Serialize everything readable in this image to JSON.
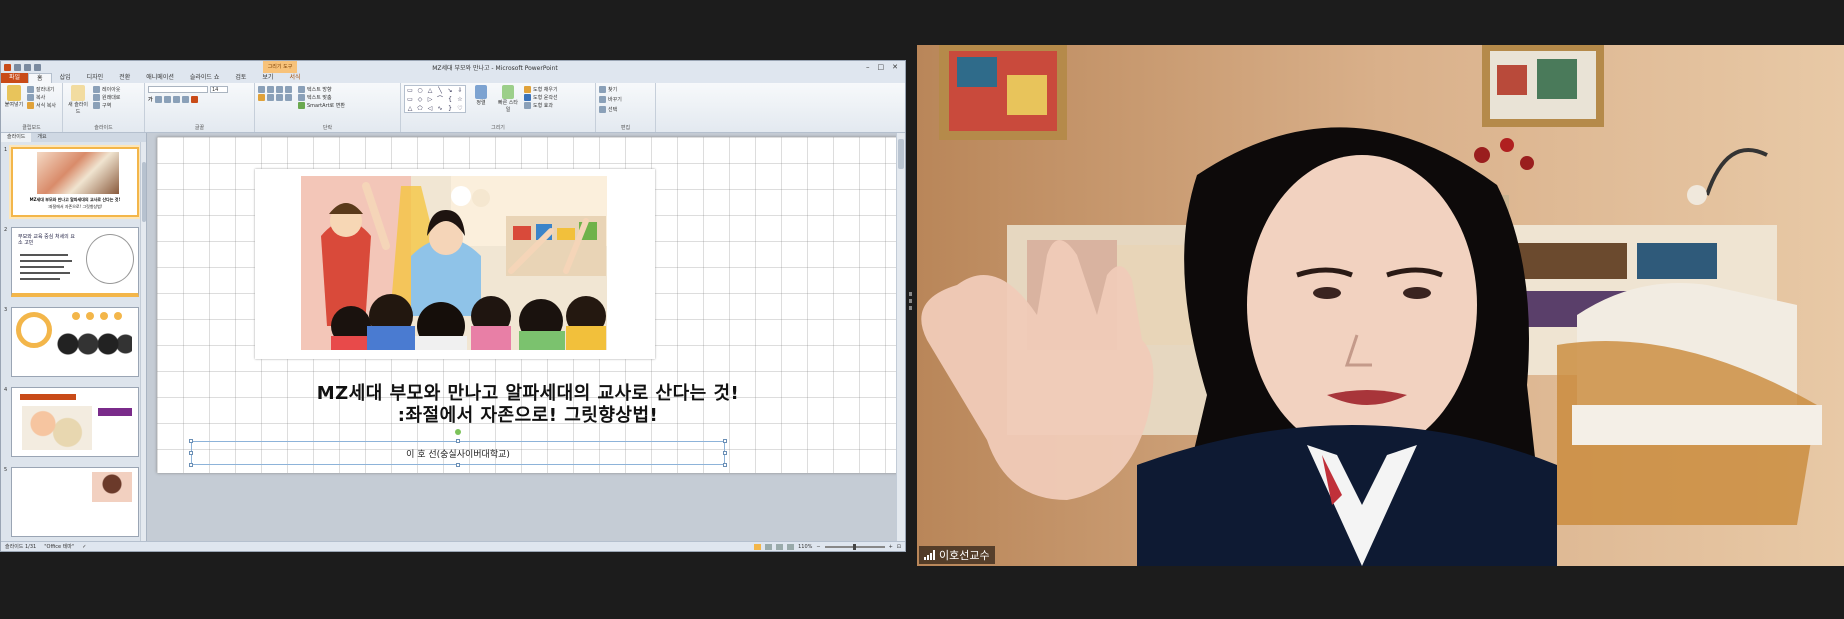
{
  "ppt": {
    "window_title": "MZ세대 부모와 만나고 - Microsoft PowerPoint",
    "context_tab": "그리기 도구",
    "tabs": [
      "파일",
      "홈",
      "삽입",
      "디자인",
      "전환",
      "애니메이션",
      "슬라이드 쇼",
      "검토",
      "보기",
      "서식"
    ],
    "ribbon_groups": {
      "clipboard": {
        "label": "클립보드",
        "paste": "붙여넣기",
        "cut": "잘라내기",
        "copy": "복사",
        "format_painter": "서식 복사"
      },
      "slides": {
        "label": "슬라이드",
        "new_slide": "새 슬라이드",
        "layout": "레이아웃",
        "reset": "원래대로",
        "section": "구역"
      },
      "font": {
        "label": "글꼴",
        "size": "14"
      },
      "paragraph": {
        "label": "단락",
        "text_direction": "텍스트 방향",
        "align_text": "텍스트 맞춤",
        "smartart": "SmartArt로 변환"
      },
      "drawing": {
        "label": "그리기",
        "arrange": "정렬",
        "quick_styles": "빠른 스타일",
        "fill": "도형 채우기",
        "outline": "도형 윤곽선",
        "effects": "도형 효과"
      },
      "editing": {
        "label": "편집",
        "find": "찾기",
        "replace": "바꾸기",
        "select": "선택"
      }
    },
    "thumb_tabs": [
      "슬라이드",
      "개요"
    ],
    "slides": [
      {
        "num": "1",
        "title": "MZ세대 부모와 만나고 알파세대의 교사로 산다는 것!",
        "sub": ":좌절에서 자존으로! 그릿향상법!"
      },
      {
        "num": "2",
        "title": "부모와 교육 중심 처세의 요소 고민"
      },
      {
        "num": "3"
      },
      {
        "num": "4"
      },
      {
        "num": "5"
      }
    ],
    "current_slide": {
      "title_line1": "MZ세대 부모와 만나고 알파세대의 교사로 산다는 것!",
      "title_line2": ":좌절에서 자존으로! 그릿향상법!",
      "presenter": "이 호 선(숭실사이버대학교)"
    },
    "status": {
      "slide_info": "슬라이드 1/31",
      "theme": "\"Office 테마\"",
      "zoom": "110%"
    }
  },
  "video": {
    "participant_name": "이호선교수"
  },
  "colors": {
    "file_tab": "#c94b18",
    "accent": "#f3b64a",
    "background": "#1c1c1c"
  }
}
